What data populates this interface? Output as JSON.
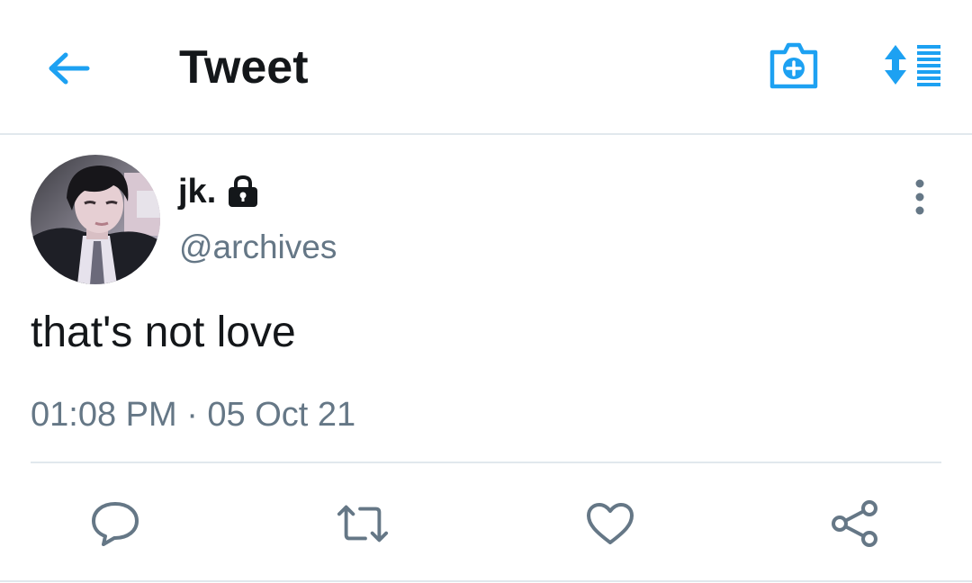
{
  "header": {
    "title": "Tweet",
    "back_icon": "arrow-left-icon",
    "camera_icon": "camera-plus-icon",
    "sort_icon": "sort-list-icon"
  },
  "author": {
    "display_name": "jk.",
    "handle": "@archives",
    "protected_icon": "lock-icon",
    "avatar": "avatar-photo"
  },
  "tweet": {
    "text": "that's not love",
    "timestamp": "01:08 PM · 05 Oct 21"
  },
  "actions": [
    {
      "name": "reply",
      "icon": "comment-icon"
    },
    {
      "name": "retweet",
      "icon": "retweet-icon"
    },
    {
      "name": "like",
      "icon": "heart-icon"
    },
    {
      "name": "share",
      "icon": "share-icon"
    }
  ],
  "colors": {
    "accent": "#1da1f2",
    "text": "#14171a",
    "secondary": "#657786",
    "divider": "#e1e8ed"
  }
}
